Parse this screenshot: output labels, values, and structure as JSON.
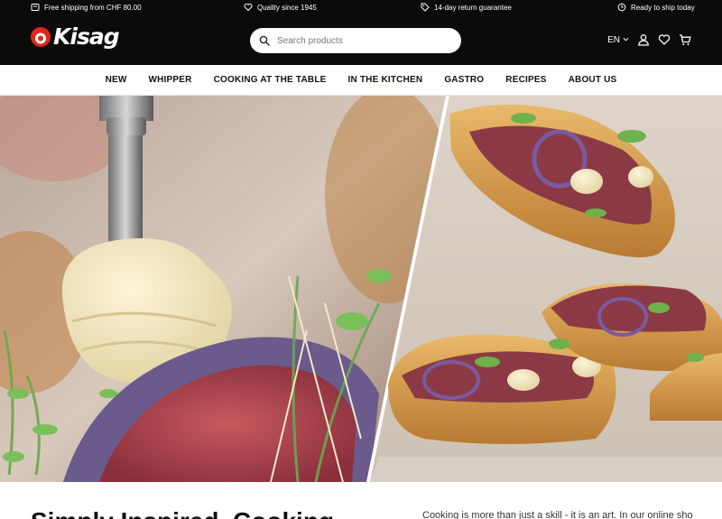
{
  "topbar": {
    "items": [
      {
        "label": "Free shipping from CHF 80.00",
        "icon": "truck-icon"
      },
      {
        "label": "Quality since 1945",
        "icon": "heart-icon"
      },
      {
        "label": "14-day return guarantee",
        "icon": "tag-icon"
      },
      {
        "label": "Ready to ship today",
        "icon": "clock-icon"
      }
    ]
  },
  "header": {
    "logo_text": "Kisag",
    "search_placeholder": "Search products",
    "language": "EN",
    "icons": [
      "user-icon",
      "heart-icon",
      "cart-icon"
    ]
  },
  "nav": {
    "items": [
      "NEW",
      "WHIPPER",
      "COOKING AT THE TABLE",
      "IN THE KITCHEN",
      "GASTRO",
      "RECIPES",
      "ABOUT US"
    ]
  },
  "intro": {
    "title": "Simply Inspired. Cooking.",
    "text": "Cooking is more than just a skill - it is an art. In our online shop,"
  },
  "colors": {
    "header_bg": "#0b0b0b",
    "logo_red": "#e3261b",
    "text": "#111111"
  }
}
